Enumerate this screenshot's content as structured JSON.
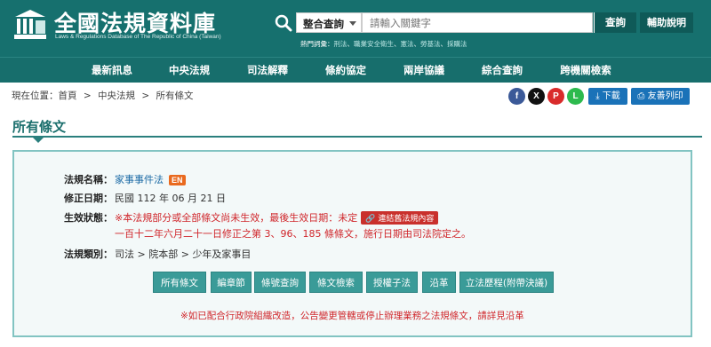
{
  "header": {
    "title": "全國法規資料庫",
    "subtitle": "Laws & Regulations Database of The Republic of China (Taiwan)",
    "search_scope": "整合查詢",
    "search_placeholder": "請輸入關鍵字",
    "search_button": "查詢",
    "help_button": "輔助說明",
    "hot_label": "熱門詞彙：",
    "hot_terms": [
      "刑法",
      "職業安全衛生",
      "憲法",
      "勞基法",
      "採購法"
    ],
    "hot_sep": "、"
  },
  "nav": [
    "最新訊息",
    "中央法規",
    "司法解釋",
    "條約協定",
    "兩岸協議",
    "綜合查詢",
    "跨機關檢索"
  ],
  "breadcrumb": {
    "prefix": "現在位置：",
    "items": [
      "首頁",
      "中央法規",
      "所有條文"
    ],
    "sep": ">"
  },
  "social": [
    {
      "icon": "facebook-icon",
      "glyph": "f",
      "color": "#3b5998"
    },
    {
      "icon": "x-icon",
      "glyph": "X",
      "color": "#111111"
    },
    {
      "icon": "plurk-icon",
      "glyph": "P",
      "color": "#d92b2b"
    },
    {
      "icon": "line-icon",
      "glyph": "L",
      "color": "#2dba4e"
    }
  ],
  "tools": {
    "download": "下載",
    "print": "友善列印"
  },
  "page_title": "所有條文",
  "law": {
    "name_label": "法規名稱：",
    "name": "家事事件法",
    "en_badge": "EN",
    "amend_label": "修正日期：",
    "amend_date": "民國 112 年 06 月 21 日",
    "status_label": "生效狀態：",
    "status_line1": "※本法規部分或全部條文尚未生效，最後生效日期：未定",
    "old_button": "連結舊法規內容",
    "status_line2": "一百十二年六月二十一日修正之第 3、96、185 條條文，施行日期由司法院定之。",
    "category_label": "法規類別：",
    "category": [
      "司法",
      "院本部",
      "少年及家事目"
    ],
    "category_sep": ">"
  },
  "actions": [
    "所有條文",
    "編章節",
    "條號查詢",
    "條文檢索",
    "授權子法",
    "沿革",
    "立法歷程(附帶決議)"
  ],
  "notice": "※如已配合行政院組織改造，公告變更管轄或停止辦理業務之法規條文，請詳見沿革",
  "colors": {
    "header": "#16706e",
    "accent": "#2a7f7d",
    "button": "#3a9b98",
    "alert": "#d0262b"
  }
}
